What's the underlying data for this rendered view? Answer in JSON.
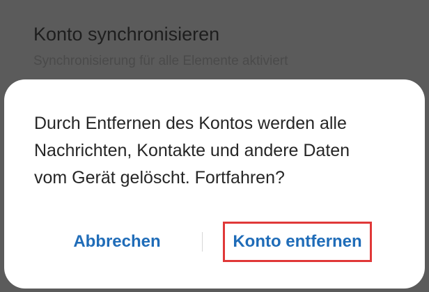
{
  "background_item": {
    "title": "Konto synchronisieren",
    "subtitle": "Synchronisierung für alle Elemente aktiviert"
  },
  "dialog": {
    "message": "Durch Entfernen des Kontos werden alle\nNachrichten, Kontakte und andere Daten\nvom Gerät gelöscht. Fortfahren?",
    "cancel_label": "Abbrechen",
    "confirm_label": "Konto entfernen"
  },
  "colors": {
    "accent": "#1f6cb8",
    "highlight_border": "#e03838",
    "dialog_background": "#ffffff",
    "scrim": "#5b5b5b"
  }
}
